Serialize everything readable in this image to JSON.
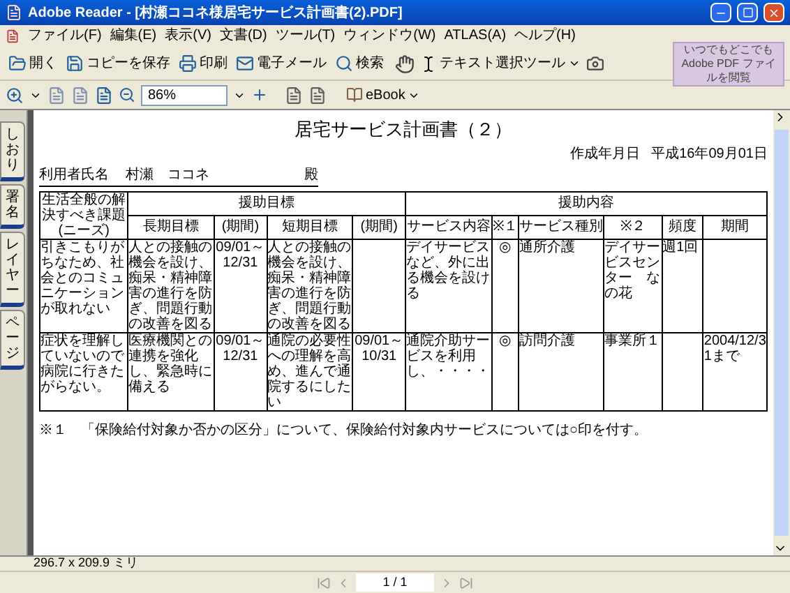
{
  "window": {
    "title": "Adobe Reader - [村瀬ココネ様居宅サービス計画書(2).PDF]"
  },
  "menu": [
    "ファイル(F)",
    "編集(E)",
    "表示(V)",
    "文書(D)",
    "ツール(T)",
    "ウィンドウ(W)",
    "ATLAS(A)",
    "ヘルプ(H)"
  ],
  "toolbar": [
    {
      "label": "開く",
      "kind": "open"
    },
    {
      "label": "コピーを保存",
      "kind": "save"
    },
    {
      "label": "印刷",
      "kind": "print"
    },
    {
      "label": "電子メール",
      "kind": "mail"
    },
    {
      "label": "検索",
      "kind": "search"
    }
  ],
  "text_tool": {
    "label": "テキスト選択ツール"
  },
  "promo": "いつでもどこでも Adobe PDF ファイルを閲覧",
  "zoom": {
    "value": "86%"
  },
  "ebook": {
    "label": "eBook"
  },
  "side_tabs": [
    {
      "label": "しおり",
      "selected": false
    },
    {
      "label": "署名",
      "selected": false
    },
    {
      "label": "レイヤー",
      "selected": false
    },
    {
      "label": "ページ",
      "selected": false
    }
  ],
  "document": {
    "title": "居宅サービス計画書（２）",
    "date_label": "作成年月日",
    "date": "平成16年09月01日",
    "client_label": "利用者氏名",
    "client_name": "村瀬　ココネ",
    "honorific": "殿",
    "group_headers": [
      {
        "label": "援助目標"
      },
      {
        "label": "援助内容"
      }
    ],
    "columns": [
      "生活全般の解決すべき課題　(ニーズ)",
      "長期目標",
      "(期間)",
      "短期目標",
      "(期間)",
      "サービス内容",
      "※１",
      "サービス種別",
      "※２",
      "頻度",
      "期間"
    ],
    "rows": [
      [
        "引きこもりがちなため、社会とのコミュニケーションが取れない",
        "人との接触の機会を設け、痴呆・精神障害の進行を防ぎ、問題行動の改善を図る",
        "09/01～12/31",
        "人との接触の機会を設け、痴呆・精神障害の進行を防ぎ、問題行動の改善を図る",
        null,
        "デイサービスなど、外に出る機会を設ける",
        "◎",
        "通所介護",
        "デイサービスセンター　なの花",
        "週1回",
        null
      ],
      [
        "症状を理解していないので病院に行きたがらない。",
        "医療機関との連携を強化し、緊急時に備える",
        "09/01～12/31",
        "通院の必要性への理解を高め、進んで通院するにしたい",
        "09/01～10/31",
        "通院介助サービスを利用し、・・・・",
        "◎",
        "訪問介護",
        "事業所１",
        null,
        "2004/12/31まで"
      ]
    ],
    "footnote": "※１　「保険給付対象か否かの区分」について、保険給付対象内サービスについては○印を付す。"
  },
  "status": {
    "page_size": "296.7 x 209.9 ミリ",
    "page": "1 / 1"
  }
}
